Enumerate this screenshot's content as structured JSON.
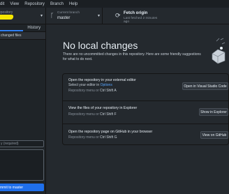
{
  "menu": {
    "items": [
      "dit",
      "View",
      "Repository",
      "Branch",
      "Help"
    ]
  },
  "toolbar": {
    "repo": {
      "caption": "epository"
    },
    "branch": {
      "caption": "Current branch",
      "value": "master"
    },
    "fetch": {
      "title": "Fetch origin",
      "subtitle": "Last fetched 2 minutes ago"
    }
  },
  "sidebar": {
    "tabs": [
      {
        "label": ""
      },
      {
        "label": "History"
      }
    ],
    "changed_files": "changed files",
    "summary_placeholder": "y (required)",
    "commit_label": "mmit to master"
  },
  "main": {
    "heading": "No local changes",
    "subtitle": "There are no uncommitted changes in this repository. Here are some friendly suggestions for what to do next.",
    "suggestions": [
      {
        "title": "Open the repository in your external editor",
        "line": "Select your editor in",
        "link": "Options",
        "menu_prefix": "Repository menu or",
        "shortcut": "Ctrl  Shift  A",
        "button": "Open in Visual Studio Code"
      },
      {
        "title": "View the files of your repository in Explorer",
        "menu_prefix": "Repository menu or",
        "shortcut": "Ctrl  Shift  F",
        "button": "Show in Explorer"
      },
      {
        "title": "Open the repository page on GitHub in your browser",
        "menu_prefix": "Repository menu or",
        "shortcut": "Ctrl  Shift  G",
        "button": "View on GitHub"
      }
    ]
  }
}
